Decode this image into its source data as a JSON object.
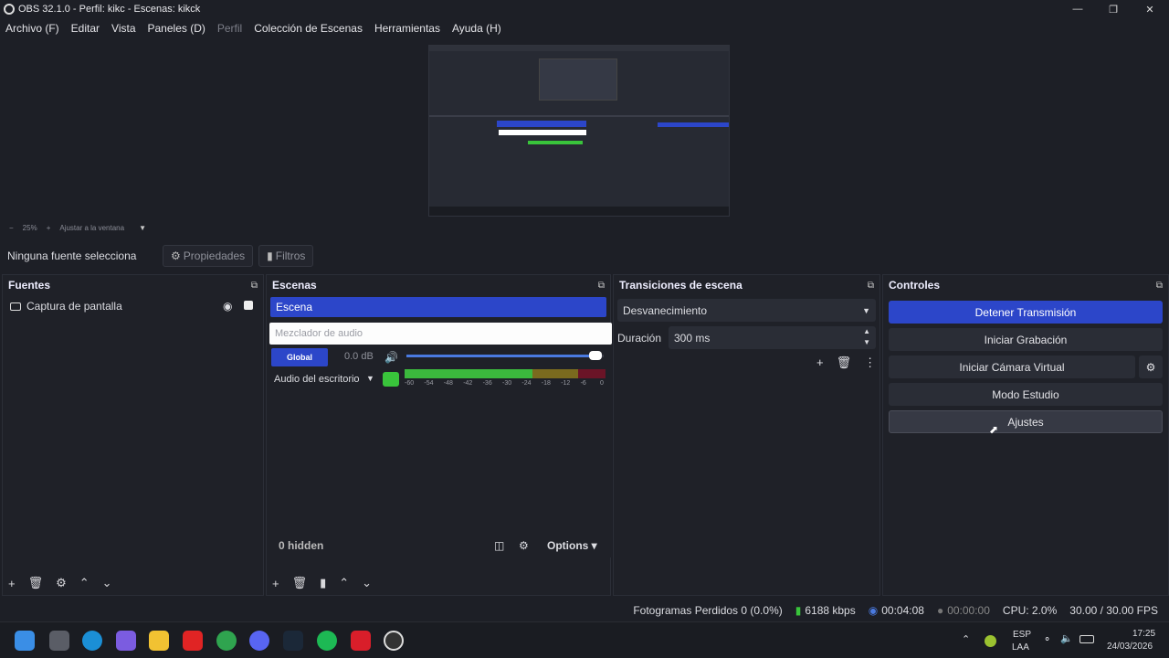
{
  "window": {
    "title": "OBS 32.1.0 - Perfil: kikc - Escenas: kikck"
  },
  "menu": [
    "Archivo (F)",
    "Editar",
    "Vista",
    "Paneles (D)",
    "Perfil",
    "Colección de Escenas",
    "Herramientas",
    "Ayuda (H)"
  ],
  "zoom": {
    "minus": "−",
    "value": "25%",
    "plus": "+",
    "fit": "Ajustar a la ventana"
  },
  "source_bar": {
    "label": "Ninguna fuente selecciona",
    "properties": "Propiedades",
    "filters": "Filtros"
  },
  "docks": {
    "sources": {
      "title": "Fuentes",
      "items": [
        {
          "name": "Captura de pantalla"
        }
      ]
    },
    "scenes": {
      "title": "Escenas",
      "items": [
        "Escena"
      ]
    },
    "mixer": {
      "title": "Mezclador de audio",
      "global_label": "Global",
      "global_db": "0.0 dB",
      "device": "Audio del escritorio",
      "volume_fraction": 0.98,
      "ticks": [
        "-60",
        "-54",
        "-48",
        "-42",
        "-36",
        "-30",
        "-24",
        "-18",
        "-12",
        "-6",
        "0"
      ],
      "hidden": "0 hidden",
      "options": "Options"
    },
    "transitions": {
      "title": "Transiciones de escena",
      "type": "Desvanecimiento",
      "duration_label": "Duración",
      "duration_value": "300 ms"
    },
    "controls": {
      "title": "Controles",
      "stop_stream": "Detener Transmisión",
      "start_recording": "Iniciar Grabación",
      "start_virtual_cam": "Iniciar Cámara Virtual",
      "studio_mode": "Modo Estudio",
      "settings": "Ajustes"
    }
  },
  "status": {
    "dropped": "Fotogramas Perdidos 0 (0.0%)",
    "bitrate": "6188 kbps",
    "stream_time": "00:04:08",
    "rec_time": "00:00:00",
    "cpu": "CPU: 2.0%",
    "fps": "30.00 / 30.00 FPS"
  },
  "taskbar": {
    "lang1": "ESP",
    "lang2": "LAA",
    "time": "17:25",
    "date": "24/03/2026"
  },
  "colors": {
    "accent": "#2c46c9",
    "bg": "#1d1f26",
    "dock": "#1f2128",
    "meter_green": "#39c43b"
  }
}
